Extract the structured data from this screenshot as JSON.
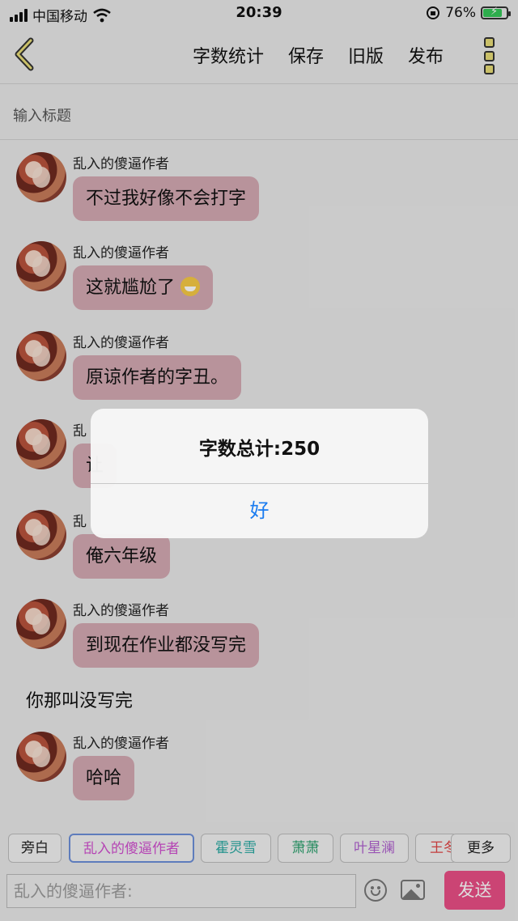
{
  "status_bar": {
    "carrier": "中国移动",
    "time": "20:39",
    "battery": "76%",
    "battery_level": 0.76
  },
  "nav": {
    "actions": [
      "字数统计",
      "保存",
      "旧版",
      "发布"
    ]
  },
  "title_placeholder": "输入标题",
  "messages": [
    {
      "author": "乱入的傻逼作者",
      "text": "不过我好像不会打字"
    },
    {
      "author": "乱入的傻逼作者",
      "text": "这就尴尬了"
    },
    {
      "author": "乱入的傻逼作者",
      "text": "原谅作者的字丑。"
    },
    {
      "author": "乱",
      "text": "让"
    },
    {
      "author": "乱",
      "text": "俺六年级"
    },
    {
      "author": "乱入的傻逼作者",
      "text": "到现在作业都没写完"
    },
    {
      "author": "乱入的傻逼作者",
      "text": "哈哈"
    }
  ],
  "narration": "你那叫没写完",
  "alert": {
    "message": "字数总计:250",
    "button": "好"
  },
  "roles": [
    {
      "label": "旁白",
      "color": "#222222"
    },
    {
      "label": "乱入的傻逼作者",
      "color": "#d04fcf"
    },
    {
      "label": "霍灵雪",
      "color": "#2aa9a2"
    },
    {
      "label": "萧萧",
      "color": "#2aa06d"
    },
    {
      "label": "叶星澜",
      "color": "#b062cf"
    },
    {
      "label": "王冬",
      "color": "#e04646"
    },
    {
      "label": "更多",
      "color": "#222222"
    }
  ],
  "input": {
    "placeholder": "乱入的傻逼作者:",
    "send_label": "发送"
  }
}
